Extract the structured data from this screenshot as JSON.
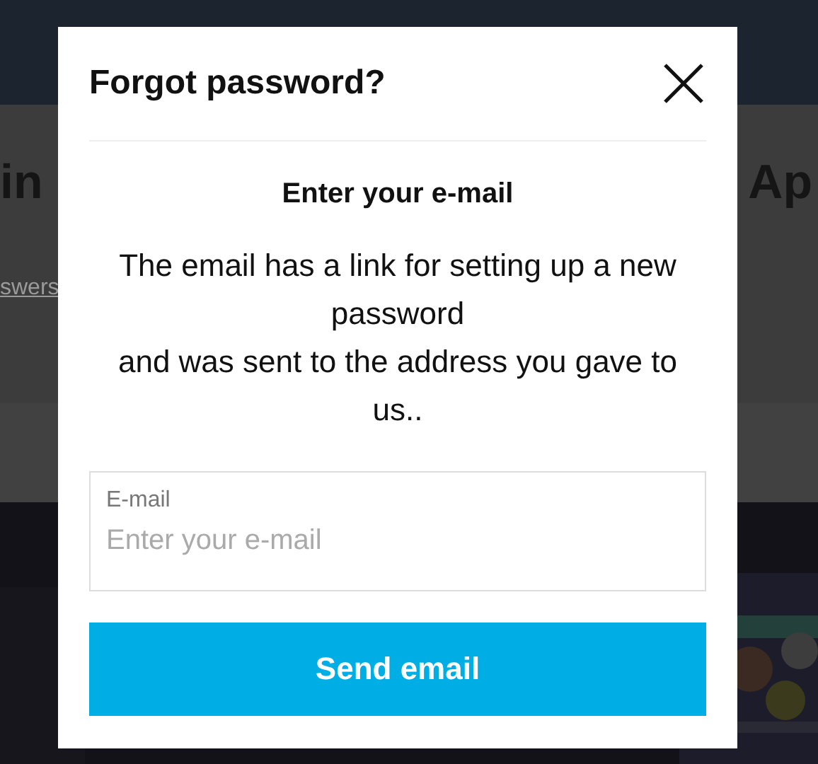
{
  "backdrop": {
    "heading_left": "in",
    "heading_right": "Ap",
    "link": "swers"
  },
  "dialog": {
    "title": "Forgot password?",
    "heading": "Enter your e-mail",
    "message": "The email has a link for setting up a new password\nand was sent to the address you gave to us..",
    "field": {
      "label": "E-mail",
      "placeholder": "Enter your e-mail"
    },
    "button": "Send email"
  }
}
